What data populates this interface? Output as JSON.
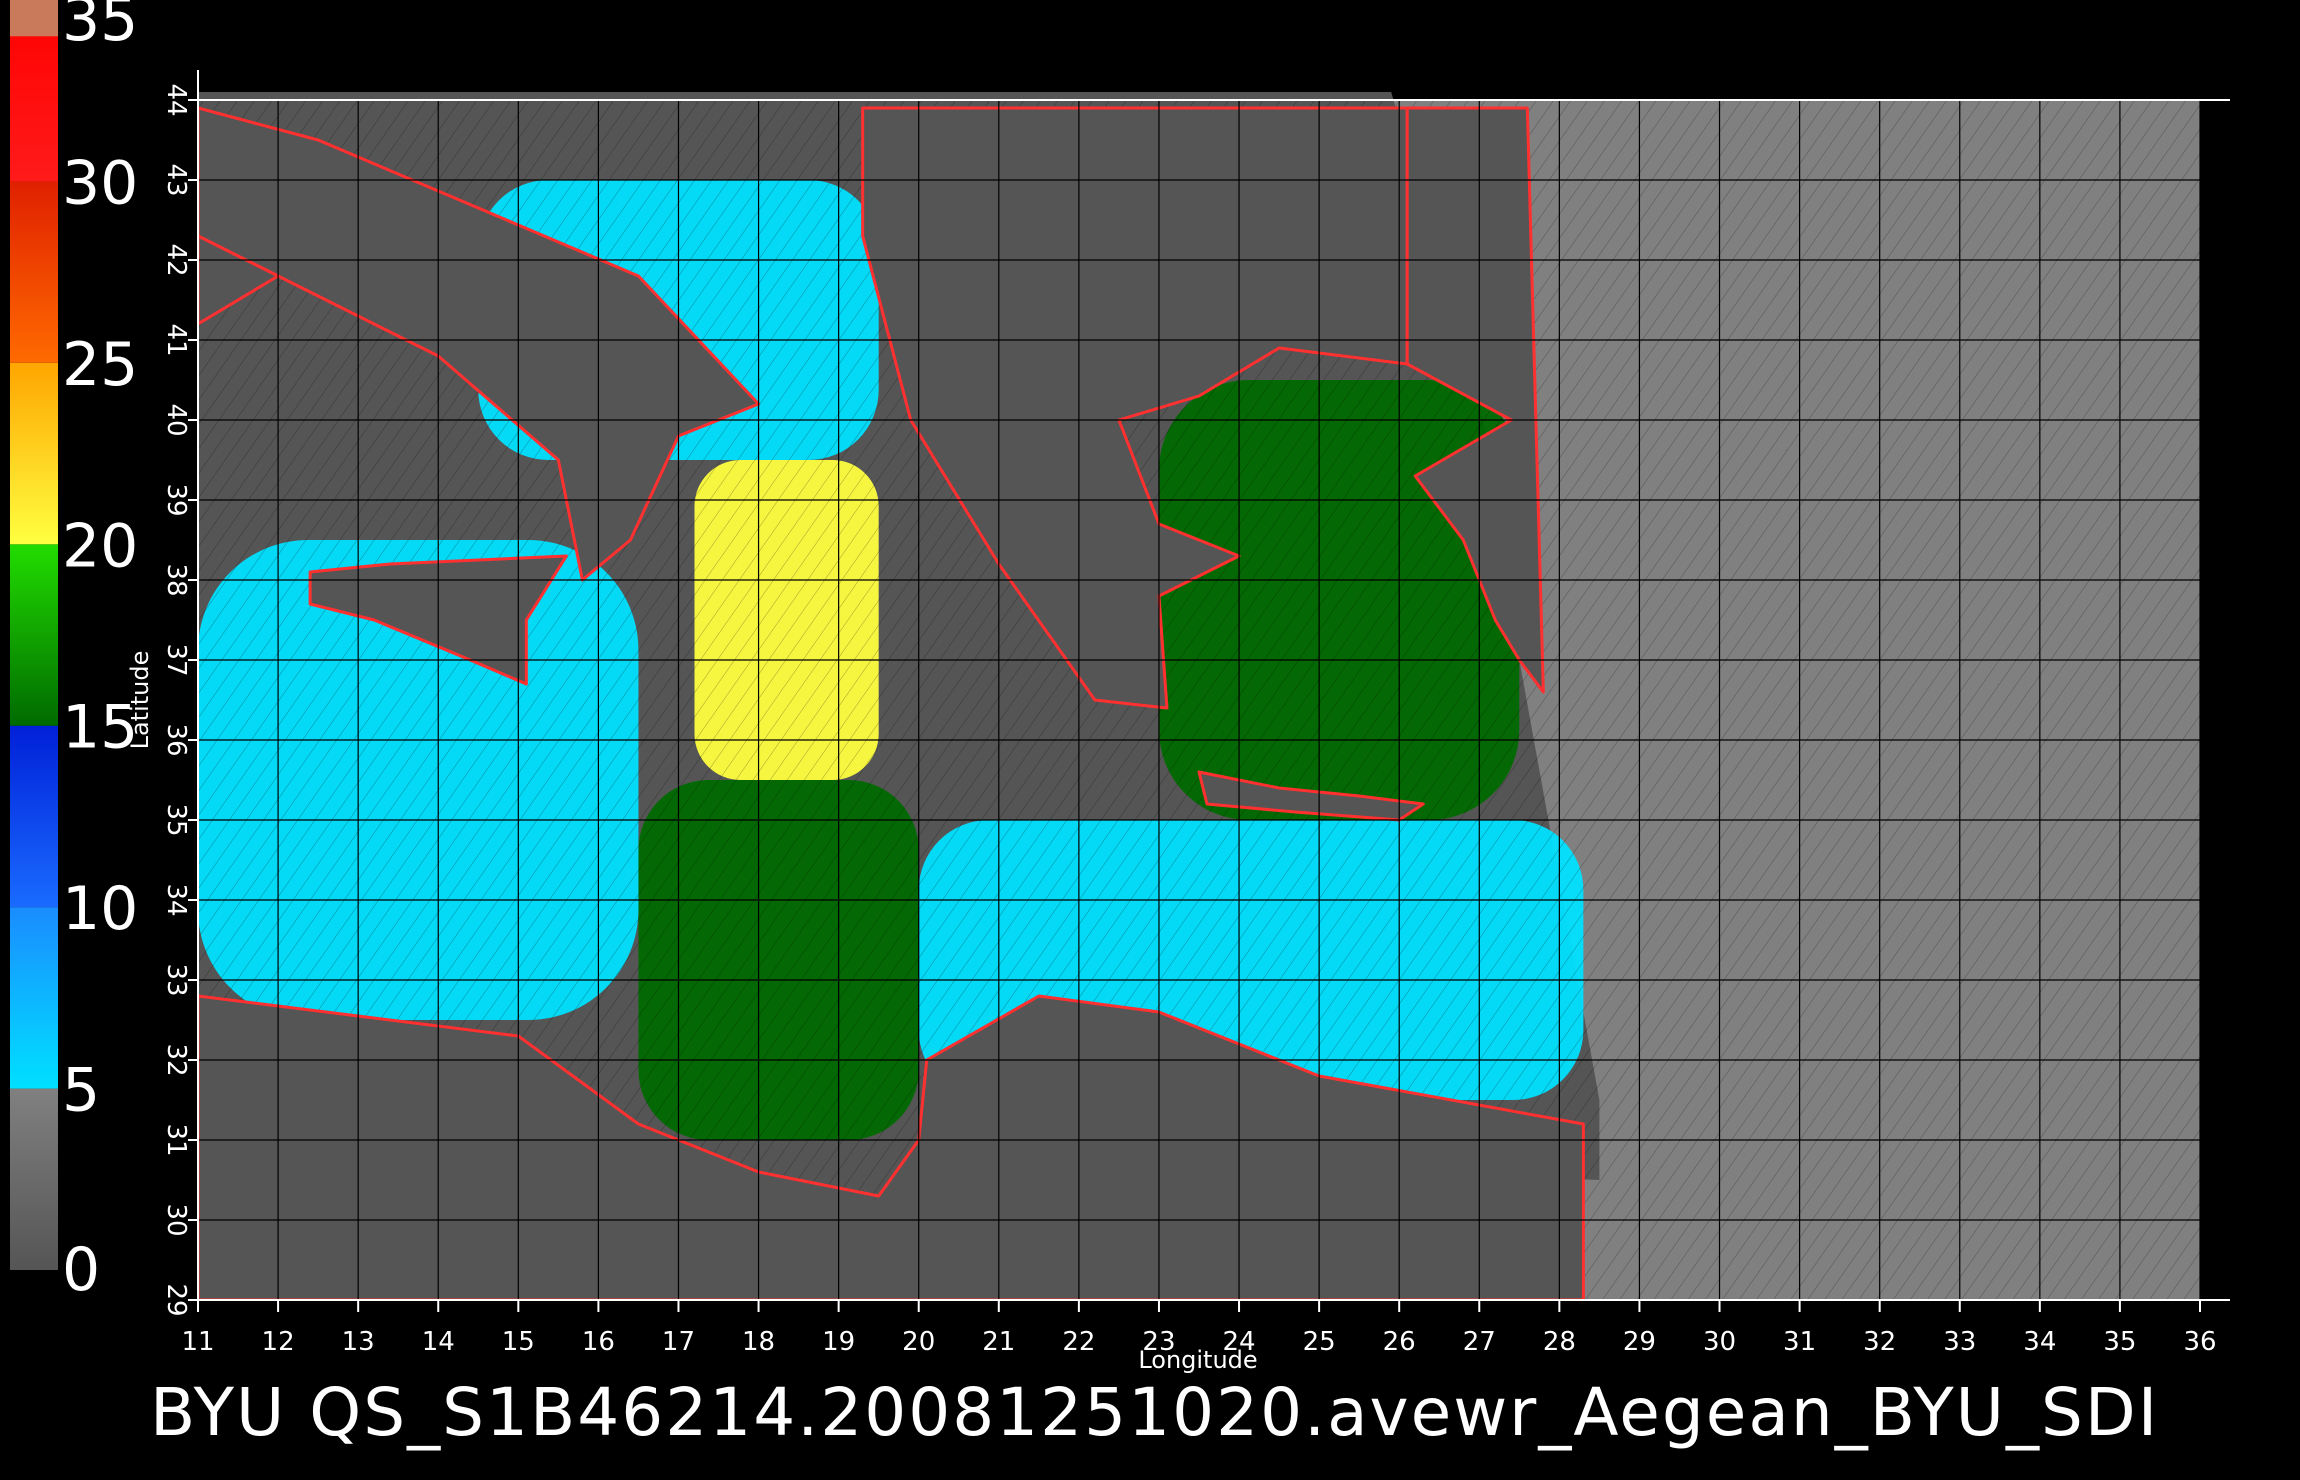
{
  "footer_text": "BYU  QS_S1B46214.20081251020.avewr_Aegean_BYU_SDI",
  "colors": {
    "background": "#000000",
    "land": "#555555",
    "outside_swath": "#808080",
    "grid": "#000000",
    "axis": "#ffffff"
  },
  "chart_data": {
    "type": "heatmap",
    "xlabel": "Longitude",
    "ylabel": "Latitude",
    "xlim": [
      11,
      36
    ],
    "ylim": [
      29,
      44
    ],
    "x_ticks": [
      "11",
      "12",
      "13",
      "14",
      "15",
      "16",
      "17",
      "18",
      "19",
      "20",
      "21",
      "22",
      "23",
      "24",
      "25",
      "26",
      "27",
      "28",
      "29",
      "30",
      "31",
      "32",
      "33",
      "34",
      "35",
      "36"
    ],
    "y_ticks": [
      "29",
      "30",
      "31",
      "32",
      "33",
      "34",
      "35",
      "36",
      "37",
      "38",
      "39",
      "40",
      "41",
      "42",
      "43",
      "44"
    ],
    "colorbar": {
      "range": [
        0,
        35
      ],
      "labels": [
        "0",
        "5",
        "10",
        "15",
        "20",
        "25",
        "30",
        "35"
      ],
      "bands": [
        {
          "from": 0,
          "to": 5,
          "color": "#555555",
          "color2": "#808080"
        },
        {
          "from": 5,
          "to": 10,
          "color": "#00e0ff",
          "color2": "#1a8cff"
        },
        {
          "from": 10,
          "to": 15,
          "color": "#1a6bff",
          "color2": "#0020d8"
        },
        {
          "from": 15,
          "to": 20,
          "color": "#006a00",
          "color2": "#22dd00"
        },
        {
          "from": 20,
          "to": 25,
          "color": "#ffff40",
          "color2": "#ffa500"
        },
        {
          "from": 25,
          "to": 30,
          "color": "#ff6a00",
          "color2": "#e02000"
        },
        {
          "from": 30,
          "to": 35,
          "color": "#ff1a1a",
          "color2": "#ff0000"
        },
        {
          "from": 34,
          "to": 35,
          "color": "#c87a5a",
          "color2": "#c87a5a"
        }
      ]
    },
    "wind_regions": [
      {
        "name": "central-high",
        "lon": [
          17.2,
          19.5
        ],
        "lat": [
          35.5,
          39.5
        ],
        "value": 22
      },
      {
        "name": "central-mid",
        "lon": [
          16.5,
          20.0
        ],
        "lat": [
          31.0,
          35.5
        ],
        "value": 16
      },
      {
        "name": "aegean",
        "lon": [
          23.0,
          27.5
        ],
        "lat": [
          35.0,
          40.5
        ],
        "value": 15
      },
      {
        "name": "west-basin",
        "lon": [
          11.0,
          16.5
        ],
        "lat": [
          32.5,
          38.5
        ],
        "value": 8
      },
      {
        "name": "east-basin",
        "lon": [
          20.0,
          28.3
        ],
        "lat": [
          31.5,
          35.0
        ],
        "value": 9
      },
      {
        "name": "adriatic",
        "lon": [
          14.5,
          19.5
        ],
        "lat": [
          39.5,
          43.0
        ],
        "value": 9
      }
    ],
    "land_masses": [
      {
        "name": "italy-south",
        "poly": [
          [
            12.5,
            43.5
          ],
          [
            16.5,
            41.8
          ],
          [
            18.0,
            40.2
          ],
          [
            17.0,
            39.8
          ],
          [
            16.4,
            38.5
          ],
          [
            15.8,
            38.0
          ],
          [
            15.5,
            39.5
          ],
          [
            14.0,
            40.8
          ],
          [
            12.0,
            41.8
          ],
          [
            11.0,
            42.3
          ],
          [
            11.0,
            43.9
          ]
        ]
      },
      {
        "name": "balkans",
        "poly": [
          [
            19.3,
            43.9
          ],
          [
            19.3,
            42.3
          ],
          [
            19.9,
            40.0
          ],
          [
            21.0,
            38.2
          ],
          [
            22.2,
            36.5
          ],
          [
            23.1,
            36.4
          ],
          [
            23.0,
            37.8
          ],
          [
            24.0,
            38.3
          ],
          [
            23.0,
            38.7
          ],
          [
            22.5,
            40.0
          ],
          [
            23.5,
            40.3
          ],
          [
            24.5,
            40.9
          ],
          [
            26.1,
            40.7
          ],
          [
            26.1,
            43.9
          ]
        ]
      },
      {
        "name": "sicily",
        "poly": [
          [
            12.4,
            38.1
          ],
          [
            13.4,
            38.2
          ],
          [
            15.6,
            38.3
          ],
          [
            15.1,
            37.5
          ],
          [
            15.1,
            36.7
          ],
          [
            14.4,
            37.0
          ],
          [
            13.2,
            37.5
          ],
          [
            12.4,
            37.7
          ]
        ]
      },
      {
        "name": "sardinia-area",
        "poly": [
          [
            11.0,
            42.3
          ],
          [
            12.0,
            41.8
          ],
          [
            11.0,
            41.2
          ]
        ]
      },
      {
        "name": "crete",
        "poly": [
          [
            23.5,
            35.6
          ],
          [
            24.5,
            35.4
          ],
          [
            25.5,
            35.3
          ],
          [
            26.3,
            35.2
          ],
          [
            26.0,
            35.0
          ],
          [
            24.7,
            35.1
          ],
          [
            23.6,
            35.2
          ]
        ]
      },
      {
        "name": "turkey",
        "poly": [
          [
            27.4,
            40.0
          ],
          [
            26.2,
            39.3
          ],
          [
            26.8,
            38.5
          ],
          [
            27.2,
            37.5
          ],
          [
            27.5,
            37.0
          ],
          [
            27.8,
            36.6
          ],
          [
            27.6,
            43.9
          ],
          [
            26.1,
            43.9
          ],
          [
            26.1,
            40.7
          ]
        ]
      },
      {
        "name": "libya",
        "poly": [
          [
            11.0,
            32.8
          ],
          [
            15.0,
            32.3
          ],
          [
            16.5,
            31.2
          ],
          [
            18.0,
            30.6
          ],
          [
            19.5,
            30.3
          ],
          [
            20.0,
            31.0
          ],
          [
            20.1,
            32.0
          ],
          [
            21.5,
            32.8
          ],
          [
            23.0,
            32.6
          ],
          [
            25.0,
            31.8
          ],
          [
            28.3,
            31.2
          ],
          [
            28.3,
            29.0
          ],
          [
            11.0,
            29.0
          ]
        ]
      }
    ]
  }
}
